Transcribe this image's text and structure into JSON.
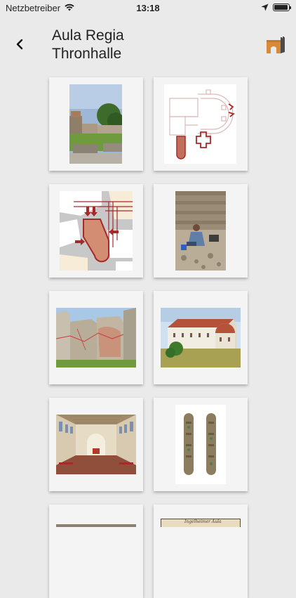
{
  "status_bar": {
    "carrier": "Netzbetreiber",
    "time": "13:18",
    "wifi_icon": "wifi-icon",
    "location_icon": "location-arrow-icon",
    "battery_icon": "battery-icon"
  },
  "header": {
    "title_line1": "Aula Regia",
    "title_line2": "Thronhalle",
    "back_icon": "chevron-left-icon",
    "logo_icon": "castle-logo-icon"
  },
  "gallery": {
    "items": [
      {
        "subject": "photo-ruins"
      },
      {
        "subject": "floor-plan"
      },
      {
        "subject": "site-map"
      },
      {
        "subject": "photo-excavation"
      },
      {
        "subject": "photo-wall-reconstruction"
      },
      {
        "subject": "photo-basilica"
      },
      {
        "subject": "rendering-interior"
      },
      {
        "subject": "photo-artifacts"
      },
      {
        "subject": "photo-partial"
      },
      {
        "subject": "manuscript-partial"
      }
    ],
    "manuscript_caption": "Ingelheimer Aula"
  },
  "colors": {
    "background": "#eaeaea",
    "card": "#f4f4f4",
    "accent_red": "#a52a2a",
    "logo_orange": "#d78a3a"
  }
}
